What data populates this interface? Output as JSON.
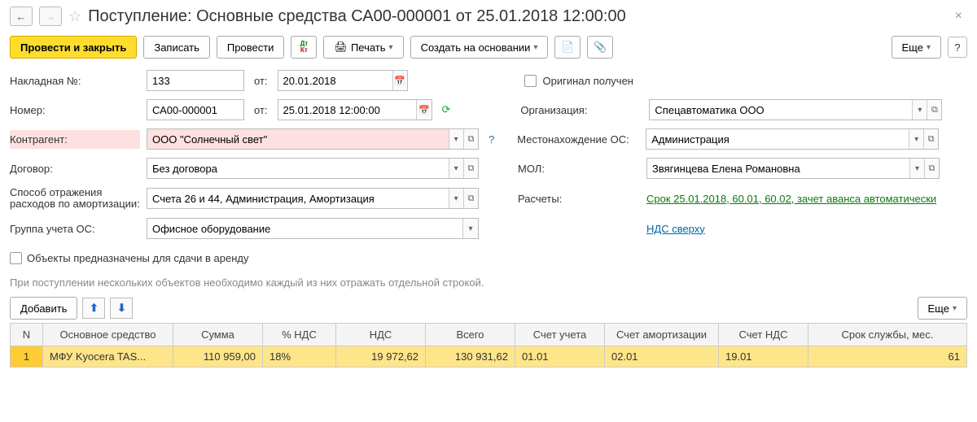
{
  "header": {
    "title": "Поступление: Основные средства СА00-000001 от 25.01.2018 12:00:00"
  },
  "toolbar": {
    "postClose": "Провести и закрыть",
    "save": "Записать",
    "post": "Провести",
    "print": "Печать",
    "createBased": "Создать на основании",
    "more": "Еще"
  },
  "form": {
    "invoiceLabel": "Накладная №:",
    "invoiceNo": "133",
    "invoiceDateLabel": "от:",
    "invoiceDate": "20.01.2018",
    "originalReceived": "Оригинал получен",
    "numberLabel": "Номер:",
    "number": "СА00-000001",
    "numberDateLabel": "от:",
    "numberDate": "25.01.2018 12:00:00",
    "orgLabel": "Организация:",
    "org": "Спецавтоматика ООО",
    "counterpartyLabel": "Контрагент:",
    "counterparty": "ООО \"Солнечный свет\"",
    "locationLabel": "Местонахождение ОС:",
    "location": "Администрация",
    "contractLabel": "Договор:",
    "contract": "Без договора",
    "molLabel": "МОЛ:",
    "mol": "Звягинцева Елена Романовна",
    "amortLabel1": "Способ отражения",
    "amortLabel2": "расходов по амортизации:",
    "amort": "Счета 26 и 44, Администрация, Амортизация",
    "calcLabel": "Расчеты:",
    "calcLink": "Срок 25.01.2018, 60.01, 60.02, зачет аванса автоматически",
    "groupLabel": "Группа учета ОС:",
    "group": "Офисное оборудование",
    "vatLink": "НДС сверху",
    "rentLabel": "Объекты предназначены для сдачи в аренду"
  },
  "hint": "При поступлении нескольких объектов необходимо каждый из них отражать отдельной строкой.",
  "tableToolbar": {
    "add": "Добавить",
    "more": "Еще"
  },
  "grid": {
    "headers": {
      "n": "N",
      "asset": "Основное средство",
      "sum": "Сумма",
      "vatPct": "% НДС",
      "vat": "НДС",
      "total": "Всего",
      "account": "Счет учета",
      "amortAcc": "Счет амортизации",
      "vatAcc": "Счет НДС",
      "life": "Срок службы, мес."
    },
    "rows": [
      {
        "n": "1",
        "asset": "МФУ Kyocera TAS...",
        "sum": "110 959,00",
        "vatPct": "18%",
        "vat": "19 972,62",
        "total": "130 931,62",
        "account": "01.01",
        "amortAcc": "02.01",
        "vatAcc": "19.01",
        "life": "61"
      }
    ]
  }
}
